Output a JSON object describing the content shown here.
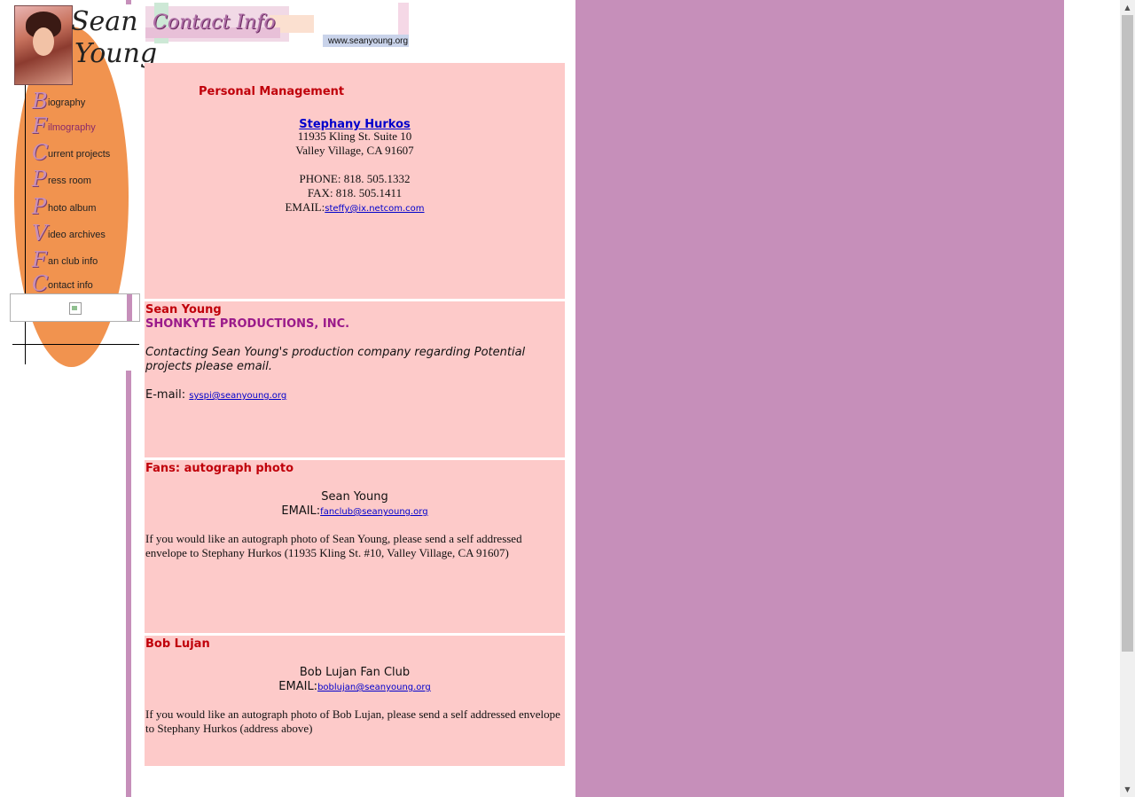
{
  "nav": {
    "logo_line1": "Sean",
    "logo_line2": "Young",
    "items": [
      {
        "initial": "B",
        "rest": "iography"
      },
      {
        "initial": "F",
        "rest": "ilmography"
      },
      {
        "initial": "C",
        "rest": "urrent projects"
      },
      {
        "initial": "P",
        "rest": "ress room"
      },
      {
        "initial": "P",
        "rest": "hoto album"
      },
      {
        "initial": "V",
        "rest": "ideo archives"
      },
      {
        "initial": "F",
        "rest": "an club info"
      },
      {
        "initial": "C",
        "rest": "ontact info"
      }
    ]
  },
  "header": {
    "title": "Contact Info",
    "url": "www.seanyoung.org"
  },
  "management": {
    "heading": "Personal Management",
    "name": "Stephany Hurkos",
    "address1": "11935 Kling St. Suite 10",
    "address2": "Valley Village, CA 91607",
    "phone": "PHONE: 818. 505.1332",
    "fax": "FAX: 818. 505.1411",
    "email_label": "EMAIL:",
    "email": "steffy@ix.netcom.com"
  },
  "production": {
    "heading": "Sean Young",
    "company": "SHONKYTE PRODUCTIONS, INC.",
    "description": "Contacting Sean Young's production company regarding Potential projects please email.",
    "email_label": "E-mail:",
    "email": "syspi@seanyoung.org"
  },
  "fans": {
    "heading": "Fans: autograph photo",
    "name": "Sean Young",
    "email_label": "EMAIL:",
    "email": "fanclub@seanyoung.org",
    "note": "If you would like an autograph photo of Sean Young, please send a self addressed envelope to Stephany Hurkos (11935 Kling St. #10, Valley Village, CA 91607)"
  },
  "lujan": {
    "heading": "Bob Lujan",
    "name": "Bob Lujan Fan Club",
    "email_label": "EMAIL:",
    "email": "boblujan@seanyoung.org",
    "note": "If you would like an autograph photo of Bob Lujan, please send a self addressed envelope to Stephany Hurkos (address above)"
  },
  "colors": {
    "panel_bg": "#fdcac9",
    "accent_purple": "#c68fba",
    "nav_orange": "#f1934f",
    "heading_red": "#c0000a",
    "company_purple": "#9a1a8a"
  }
}
